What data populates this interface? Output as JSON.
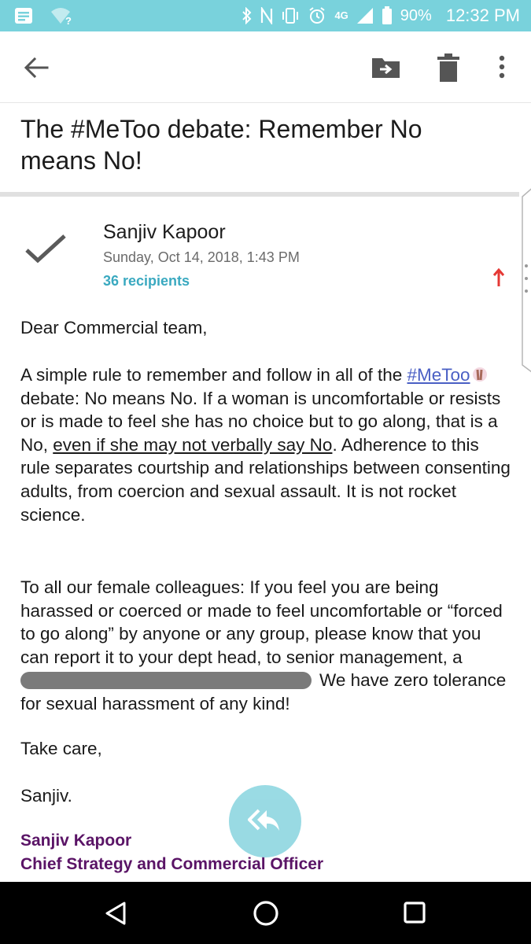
{
  "status_bar": {
    "battery": "90%",
    "time": "12:32 PM",
    "network": "4G",
    "icons": [
      "notification-icon",
      "wifi-question-icon",
      "bluetooth-icon",
      "nfc-icon",
      "vibrate-icon",
      "alarm-icon",
      "signal-icon",
      "battery-icon"
    ]
  },
  "toolbar": {
    "icons": [
      "back-arrow-icon",
      "move-to-icon",
      "trash-icon",
      "more-vert-icon"
    ]
  },
  "email": {
    "subject": "The #MeToo debate: Remember No means No!",
    "sender": "Sanjiv Kapoor",
    "date": "Sunday, Oct 14, 2018, 1:43 PM",
    "recipients": "36 recipients",
    "body": {
      "greeting": "Dear Commercial team,",
      "p1_pre": "A simple rule to remember and follow in all of the",
      "hashtag": "#MeToo",
      "p1_a": " debate: No means No. If a woman is uncomfortable or resists or is made to feel she has no choice but to go along, that is a No, ",
      "p1_underlined": "even if she may not verbally say No",
      "p1_b": ". Adherence to this rule separates courtship and relationships between consenting adults, from coercion and sexual assault. It is not rocket science.",
      "p2_a": "To all our female colleagues: If you feel you are being harassed or coerced or made to feel uncomfortable or “forced to go along” by anyone or any group, please know that you can report it to your dept head, to senior management, a",
      "p2_b": "We have zero tolerance for sexual harassment of any kind!",
      "closing": "Take care,",
      "signoff": "Sanjiv."
    },
    "signature": {
      "name": "Sanjiv Kapoor",
      "title": "Chief Strategy and Commercial Officer"
    }
  },
  "colors": {
    "status_bar": "#79d2dc",
    "recipients": "#3aa9c0",
    "hashtag": "#4a5fc4",
    "signature": "#5a1466",
    "fab": "#8fd7e1",
    "priority": "#e53935"
  },
  "fab": {
    "icon": "reply-all-icon"
  },
  "nav_bar": {
    "icons": [
      "nav-back-icon",
      "nav-home-icon",
      "nav-recents-icon"
    ]
  }
}
